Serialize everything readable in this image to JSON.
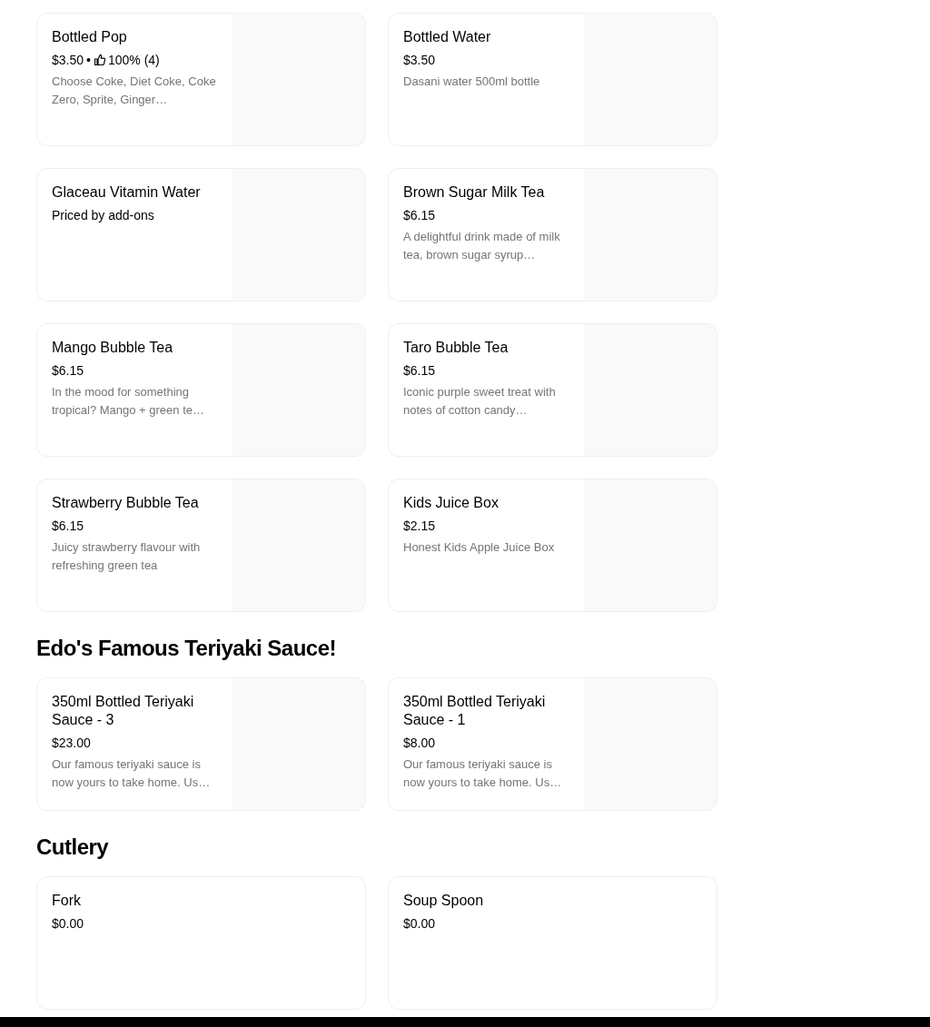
{
  "sections": [
    {
      "items": [
        {
          "name": "Bottled Pop",
          "price": "$3.50",
          "rating": {
            "separator": "•",
            "text": "100% (4)"
          },
          "description": "Choose Coke, Diet Coke, Coke Zero, Sprite, Ginger…"
        },
        {
          "name": "Bottled Water",
          "price": "$3.50",
          "description": "Dasani water 500ml bottle"
        },
        {
          "name": "Glaceau Vitamin Water",
          "price": "Priced by add-ons"
        },
        {
          "name": "Brown Sugar Milk Tea",
          "price": "$6.15",
          "description": "A delightful drink made of milk tea, brown sugar syrup…"
        },
        {
          "name": "Mango Bubble Tea",
          "price": "$6.15",
          "description": "In the mood for something tropical? Mango + green te…"
        },
        {
          "name": "Taro Bubble Tea",
          "price": "$6.15",
          "description": "Iconic purple sweet treat with notes of cotton candy…"
        },
        {
          "name": "Strawberry Bubble Tea",
          "price": "$6.15",
          "description": "Juicy strawberry flavour with refreshing green tea"
        },
        {
          "name": "Kids Juice Box",
          "price": "$2.15",
          "description": "Honest Kids Apple Juice Box"
        }
      ]
    },
    {
      "title": "Edo's Famous Teriyaki Sauce!",
      "items": [
        {
          "name": "350ml Bottled Teriyaki Sauce - 3",
          "price": "$23.00",
          "description": "Our famous teriyaki sauce is now yours to take home. Us…"
        },
        {
          "name": "350ml Bottled Teriyaki Sauce - 1",
          "price": "$8.00",
          "description": "Our famous teriyaki sauce is now yours to take home. Us…"
        }
      ]
    },
    {
      "title": "Cutlery",
      "items": [
        {
          "name": "Fork",
          "price": "$0.00"
        },
        {
          "name": "Soup Spoon",
          "price": "$0.00"
        }
      ]
    }
  ]
}
